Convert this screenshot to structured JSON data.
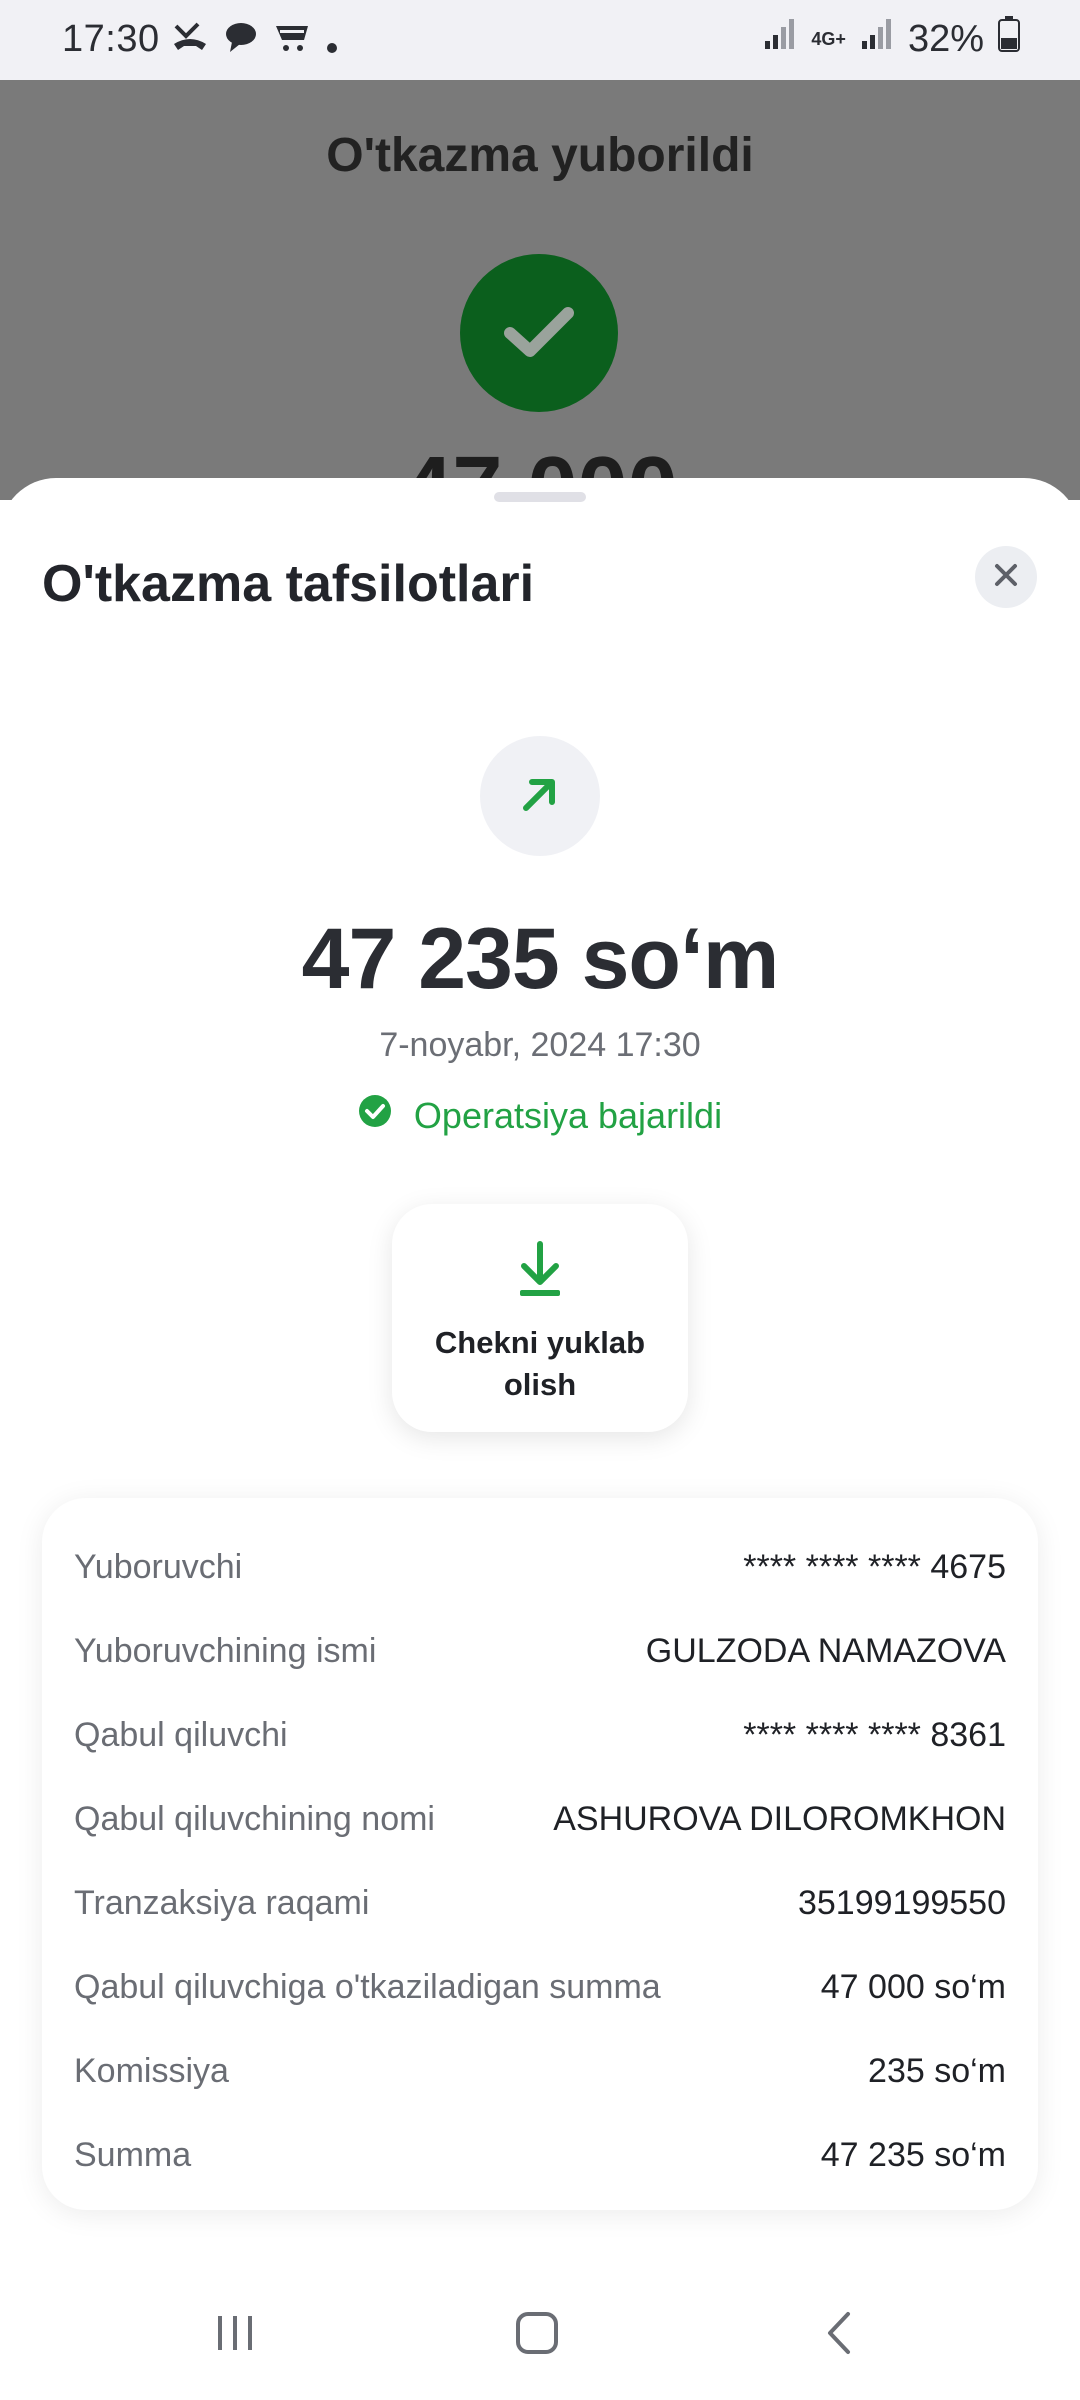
{
  "status_bar": {
    "time": "17:30",
    "network": "4G+",
    "battery": "32%"
  },
  "background_screen": {
    "title": "O'tkazma yuborildi",
    "amount_partial": "47 000"
  },
  "sheet": {
    "title": "O'tkazma tafsilotlari",
    "amount": "47 235 so‘m",
    "date": "7-noyabr, 2024 17:30",
    "status": "Operatsiya bajarildi",
    "download_label_line1": "Chekni yuklab",
    "download_label_line2": "olish"
  },
  "details": [
    {
      "label": "Yuboruvchi",
      "value": "**** **** **** 4675"
    },
    {
      "label": "Yuboruvchining ismi",
      "value": "GULZODA NAMAZOVA"
    },
    {
      "label": "Qabul qiluvchi",
      "value": "**** **** **** 8361"
    },
    {
      "label": "Qabul qiluvchining nomi",
      "value": "ASHUROVA DILOROMKHON"
    },
    {
      "label": "Tranzaksiya raqami",
      "value": "35199199550"
    },
    {
      "label": "Qabul qiluvchiga o'tkaziladigan summa",
      "value": "47 000 so‘m"
    },
    {
      "label": "Komissiya",
      "value": "235 so‘m"
    },
    {
      "label": "Summa",
      "value": "47 235 so‘m"
    }
  ],
  "colors": {
    "success_green": "#22a244",
    "dark_green": "#0b5f1d",
    "text_dark": "#2b2d33",
    "text_muted": "#6a6d74"
  },
  "icons": [
    "missed-call-icon",
    "chat-icon",
    "cart-icon",
    "signal-icon",
    "battery-icon",
    "close-icon",
    "arrow-up-right-icon",
    "check-circle-icon",
    "download-icon",
    "recent-apps-icon",
    "home-icon",
    "back-icon"
  ]
}
